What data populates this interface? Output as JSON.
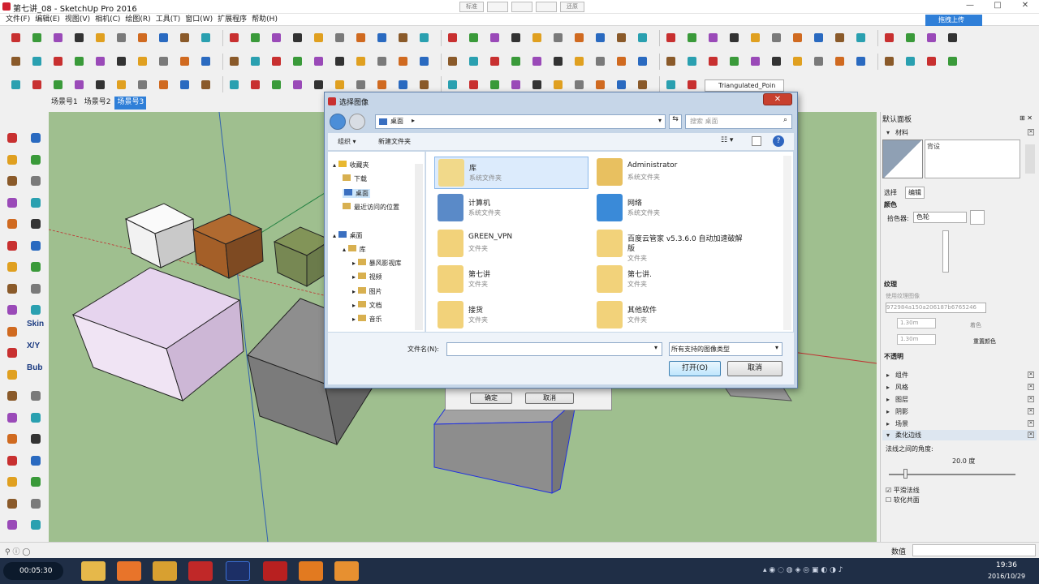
{
  "window": {
    "title": "第七讲_08 - SketchUp Pro 2016",
    "mid_buttons": [
      "标准",
      "",
      "",
      "",
      "还原"
    ],
    "minimize": "—",
    "maximize": "□",
    "close": "✕"
  },
  "menu": [
    "文件(F)",
    "编辑(E)",
    "视图(V)",
    "相机(C)",
    "绘图(R)",
    "工具(T)",
    "窗口(W)",
    "扩展程序",
    "帮助(H)"
  ],
  "toolbar": {
    "style_dropdown": "Triangulated_Poin",
    "upload_button": "拖拽上传"
  },
  "scene_tabs": [
    {
      "label": "场景号1",
      "active": false
    },
    {
      "label": "场景号2",
      "active": false
    },
    {
      "label": "场景号3",
      "active": true
    }
  ],
  "left_tools_text": [
    "Skin",
    "X/Y",
    "Bub"
  ],
  "dialog": {
    "title": "选择图像",
    "address": "桌面",
    "search_placeholder": "搜索 桌面",
    "organize": "组织 ▾",
    "new_folder": "新建文件夹",
    "nav": [
      {
        "label": "收藏夹",
        "indent": 0,
        "arrow": "▴"
      },
      {
        "label": "下载",
        "indent": 1,
        "arrow": ""
      },
      {
        "label": "桌面",
        "indent": 1,
        "arrow": "",
        "selected": true
      },
      {
        "label": "最近访问的位置",
        "indent": 1,
        "arrow": ""
      },
      {
        "label": "",
        "indent": 0,
        "arrow": ""
      },
      {
        "label": "桌面",
        "indent": 0,
        "arrow": "▴"
      },
      {
        "label": "库",
        "indent": 1,
        "arrow": "▴"
      },
      {
        "label": "暴风影视库",
        "indent": 2,
        "arrow": "▸"
      },
      {
        "label": "视频",
        "indent": 2,
        "arrow": "▸"
      },
      {
        "label": "图片",
        "indent": 2,
        "arrow": "▸"
      },
      {
        "label": "文档",
        "indent": 2,
        "arrow": "▸"
      },
      {
        "label": "音乐",
        "indent": 2,
        "arrow": "▸"
      }
    ],
    "files": [
      {
        "name": "库",
        "type": "系统文件夹",
        "icon": "library-icon",
        "selected": true
      },
      {
        "name": "Administrator",
        "type": "系统文件夹",
        "icon": "user-folder-icon"
      },
      {
        "name": "计算机",
        "type": "系统文件夹",
        "icon": "computer-icon"
      },
      {
        "name": "网络",
        "type": "系统文件夹",
        "icon": "network-icon"
      },
      {
        "name": "GREEN_VPN",
        "type": "文件夹",
        "icon": "folder-icon"
      },
      {
        "name": "百度云管家 v5.3.6.0 自动加速破解",
        "name2": "版",
        "type": "文件夹",
        "icon": "folder-icon"
      },
      {
        "name": "第七讲",
        "type": "文件夹",
        "icon": "folder-icon"
      },
      {
        "name": "第七讲.",
        "type": "文件夹",
        "icon": "folder-icon"
      },
      {
        "name": "接货",
        "type": "文件夹",
        "icon": "folder-icon"
      },
      {
        "name": "其他软件",
        "type": "文件夹",
        "icon": "folder-icon"
      }
    ],
    "filename_label": "文件名(N):",
    "filename_value": "",
    "filter": "所有支持的图像类型",
    "open_button": "打开(O)",
    "cancel_button": "取消"
  },
  "behind_dialog": {
    "ok": "确定",
    "cancel": "取消"
  },
  "panel": {
    "title": "默认面板",
    "materials": {
      "header": "材料",
      "name": "背设",
      "tabs": [
        "选择",
        "编辑"
      ],
      "color_label": "颜色",
      "picker_label": "拾色器:",
      "picker_value": "色轮",
      "texture_label": "纹理",
      "use_texture": "使用纹理图像",
      "texture_file": "972984a150a206187b6765246",
      "width": "1.30m",
      "height": "1.30m",
      "colorize": "着色",
      "reset_color": "重置颜色",
      "opacity_label": "不透明"
    },
    "sections": [
      "组件",
      "风格",
      "图层",
      "阴影",
      "场景",
      "柔化边线"
    ],
    "soften": {
      "angle_label": "法线之间的角度:",
      "angle_value": "20.0 度",
      "smooth_normals": "平滑法线",
      "soften_coplanar": "软化共面",
      "smooth_checked": true,
      "coplanar_checked": false
    }
  },
  "status": {
    "measure_label": "数值"
  },
  "taskbar": {
    "time": "19:36",
    "date": "2016/10/29",
    "timer": "00:05:30"
  }
}
